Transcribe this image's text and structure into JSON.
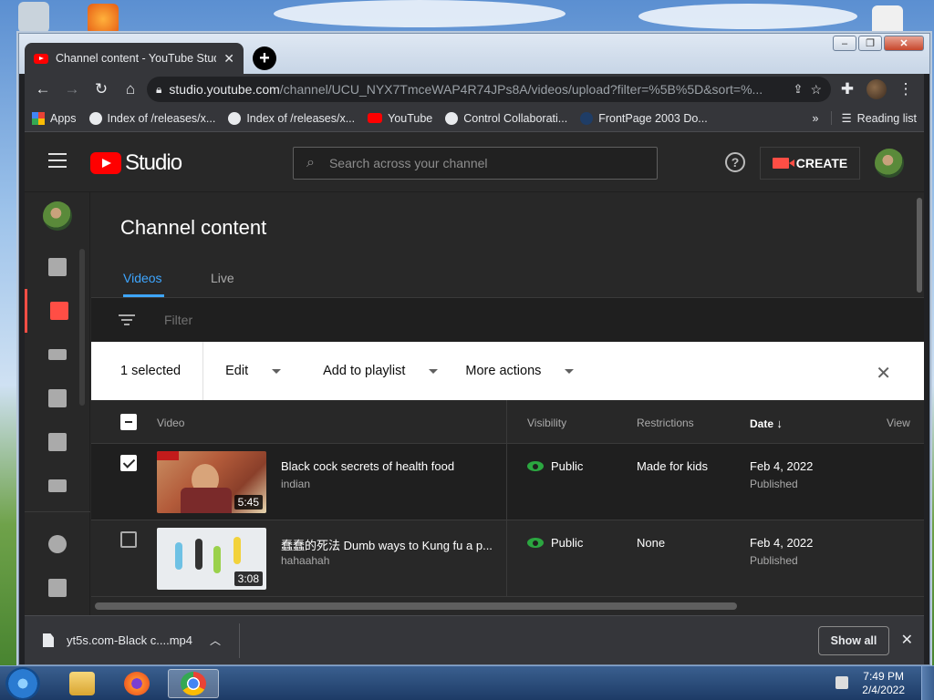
{
  "browser": {
    "tab_title": "Channel content - YouTube Studio",
    "url_host": "studio.youtube.com",
    "url_path": "/channel/UCU_NYX7TmceWAP4R74JPs8A/videos/upload?filter=%5B%5D&sort=%...",
    "bookmarks": [
      "Apps",
      "Index of /releases/x...",
      "Index of /releases/x...",
      "YouTube",
      "Control Collaborati...",
      "FrontPage 2003 Do..."
    ],
    "reading_list": "Reading list",
    "more_bookmarks": "»"
  },
  "studio": {
    "logo_text": "Studio",
    "search_placeholder": "Search across your channel",
    "create_label": "CREATE",
    "page_title": "Channel content",
    "tabs": [
      "Videos",
      "Live"
    ],
    "filter_placeholder": "Filter",
    "selection": {
      "count_label": "1 selected",
      "actions": [
        "Edit",
        "Add to playlist",
        "More actions"
      ],
      "close": "✕"
    },
    "columns": {
      "video": "Video",
      "visibility": "Visibility",
      "restrictions": "Restrictions",
      "date": "Date",
      "views": "View"
    },
    "rows": [
      {
        "title": "Black cock secrets of health food",
        "description": "indian",
        "duration": "5:45",
        "visibility": "Public",
        "restrictions": "Made for kids",
        "date": "Feb 4, 2022",
        "status": "Published",
        "selected": true
      },
      {
        "title": "蠢蠢的死法 Dumb ways to Kung fu a p...",
        "description": "hahaahah",
        "duration": "3:08",
        "visibility": "Public",
        "restrictions": "None",
        "date": "Feb 4, 2022",
        "status": "Published",
        "selected": false
      }
    ]
  },
  "downloads": {
    "file_name": "yt5s.com-Black c....mp4",
    "show_all": "Show all"
  },
  "taskbar": {
    "time": "7:49 PM",
    "date": "2/4/2022"
  },
  "colors": {
    "accent_red": "#ff0000",
    "active_tab_blue": "#3ea6ff",
    "public_green": "#2ba640"
  }
}
